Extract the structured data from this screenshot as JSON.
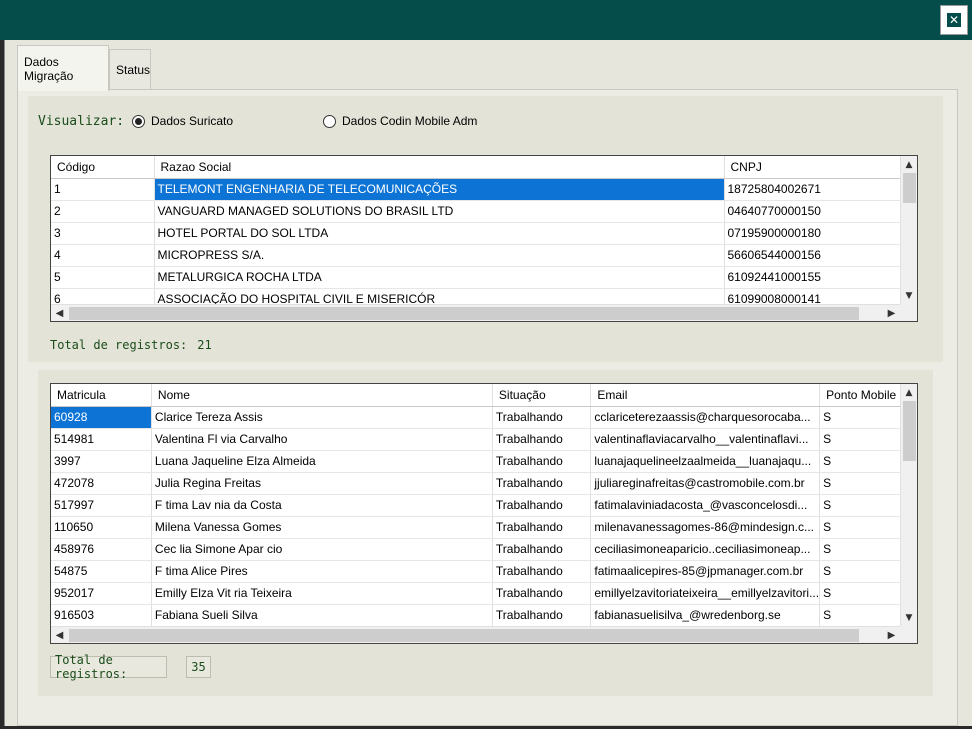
{
  "window": {
    "close_icon": "close-icon"
  },
  "tabs": [
    {
      "label": "Dados Migração",
      "active": true
    },
    {
      "label": "Status",
      "active": false
    }
  ],
  "visualizar": {
    "label": "Visualizar:",
    "options": [
      {
        "label": "Dados Suricato",
        "selected": true
      },
      {
        "label": "Dados Codin Mobile Adm",
        "selected": false
      }
    ]
  },
  "companies": {
    "columns": [
      "Código",
      "Razao Social",
      "CNPJ"
    ],
    "rows": [
      [
        "1",
        "TELEMONT ENGENHARIA DE TELECOMUNICAÇÕES",
        "18725804002671"
      ],
      [
        "2",
        "VANGUARD MANAGED SOLUTIONS DO BRASIL LTD",
        "04640770000150"
      ],
      [
        "3",
        "HOTEL PORTAL DO SOL LTDA",
        "07195900000180"
      ],
      [
        "4",
        "MICROPRESS S/A.",
        "56606544000156"
      ],
      [
        "5",
        "METALURGICA ROCHA LTDA",
        "61092441000155"
      ],
      [
        "6",
        "ASSOCIAÇÃO DO HOSPITAL CIVIL E MISERICÓR",
        "61099008000141"
      ]
    ],
    "total_label": "Total de registros:",
    "total_value": "21"
  },
  "employees": {
    "columns": [
      "Matricula",
      "Nome",
      "Situação",
      "Email",
      "Ponto Mobile"
    ],
    "rows": [
      [
        "60928",
        "Clarice Tereza Assis",
        "Trabalhando",
        "cclariceterezaassis@charquesorocaba...",
        "S"
      ],
      [
        "514981",
        "Valentina Fl via Carvalho",
        "Trabalhando",
        "valentinaflaviacarvalho__valentinaflavi...",
        "S"
      ],
      [
        "3997",
        "Luana Jaqueline Elza Almeida",
        "Trabalhando",
        "luanajaquelineelzaalmeida__luanajaqu...",
        "S"
      ],
      [
        "472078",
        "Julia Regina Freitas",
        "Trabalhando",
        "jjuliareginafreitas@castromobile.com.br",
        "S"
      ],
      [
        "517997",
        "F tima Lav nia da Costa",
        "Trabalhando",
        "fatimalaviniadacosta_@vasconcelosdi...",
        "S"
      ],
      [
        "110650",
        "Milena Vanessa Gomes",
        "Trabalhando",
        "milenavanessagomes-86@mindesign.c...",
        "S"
      ],
      [
        "458976",
        "Cec lia Simone Apar cio",
        "Trabalhando",
        "ceciliasimoneaparicio..ceciliasimoneap...",
        "S"
      ],
      [
        "54875",
        "F tima Alice Pires",
        "Trabalhando",
        "fatimaalicepires-85@jpmanager.com.br",
        "S"
      ],
      [
        "952017",
        "Emilly Elza Vit ria Teixeira",
        "Trabalhando",
        "emillyelzavitoriateixeira__emillyelzavitori...",
        "S"
      ],
      [
        "916503",
        "Fabiana Sueli Silva",
        "Trabalhando",
        "fabianasuelisilva_@wredenborg.se",
        "S"
      ]
    ],
    "total_label": "Total de registros:",
    "total_value": "35"
  },
  "colors": {
    "titlebar": "#054d4a",
    "selection": "#0d74d6",
    "label_green": "#1a4d1a"
  }
}
